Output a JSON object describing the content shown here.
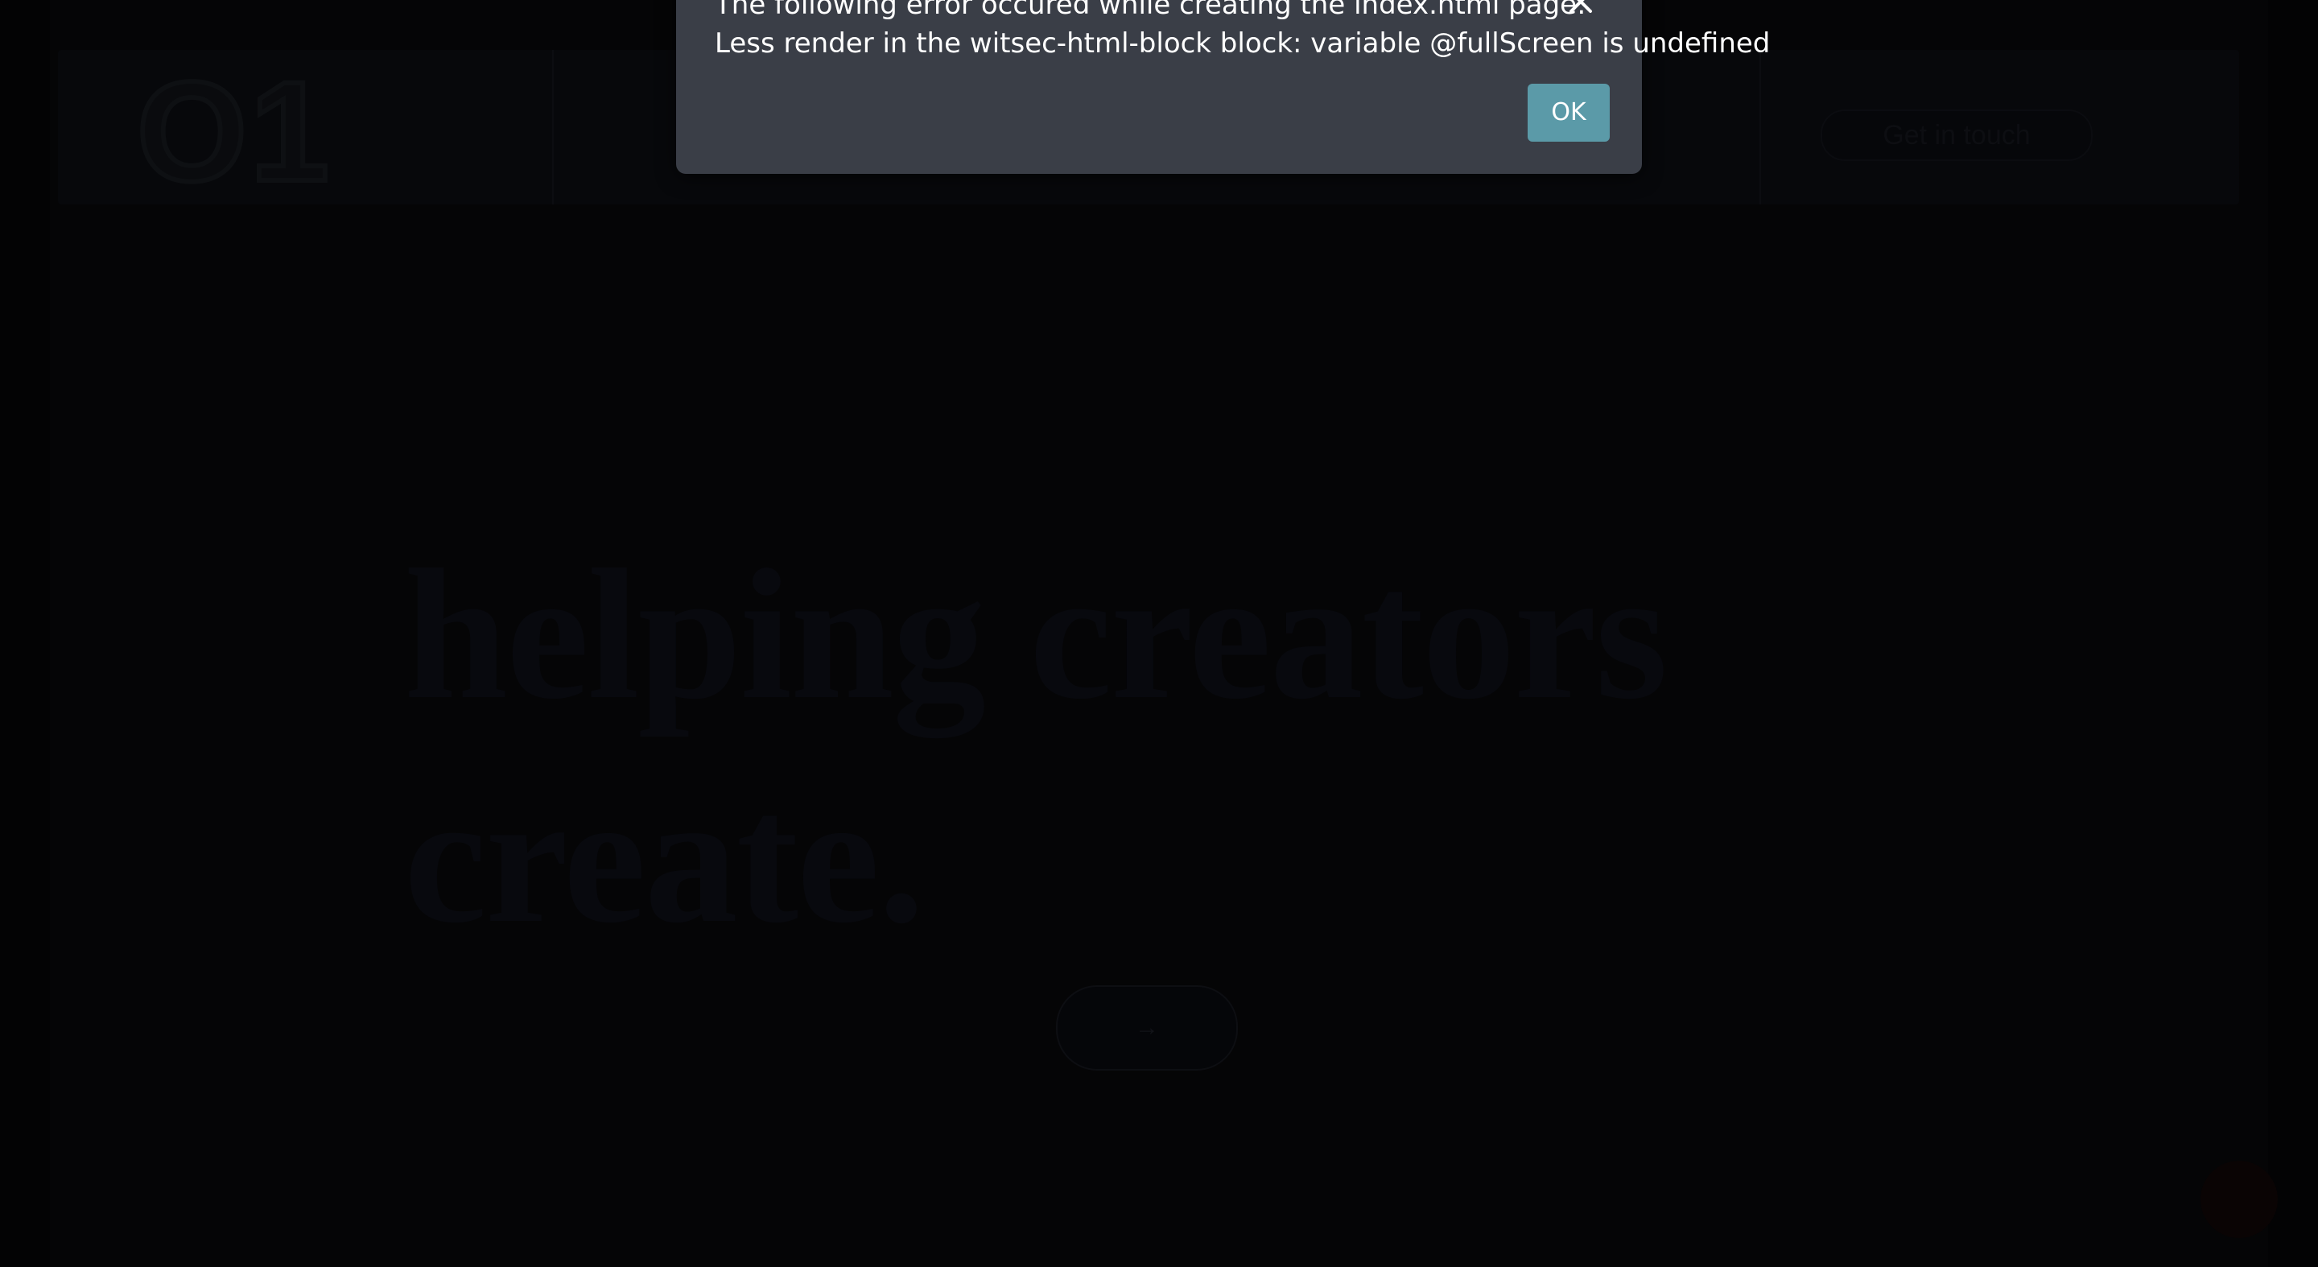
{
  "site": {
    "logo_text": "O1",
    "header_cta_label": "Get in touch",
    "hero_line_1": "helping creators",
    "hero_line_2": "create.",
    "hero_button_label": "→"
  },
  "dialog": {
    "title": "The following error occured while creating the index.html page:",
    "message": "Less render in the witsec-html-block block: variable @fullScreen is undefined",
    "ok_label": "OK",
    "close_icon": "close-icon"
  },
  "colors": {
    "dialog_background": "#3a3e47",
    "ok_button": "#5b9aa8",
    "text": "#ffffff"
  }
}
